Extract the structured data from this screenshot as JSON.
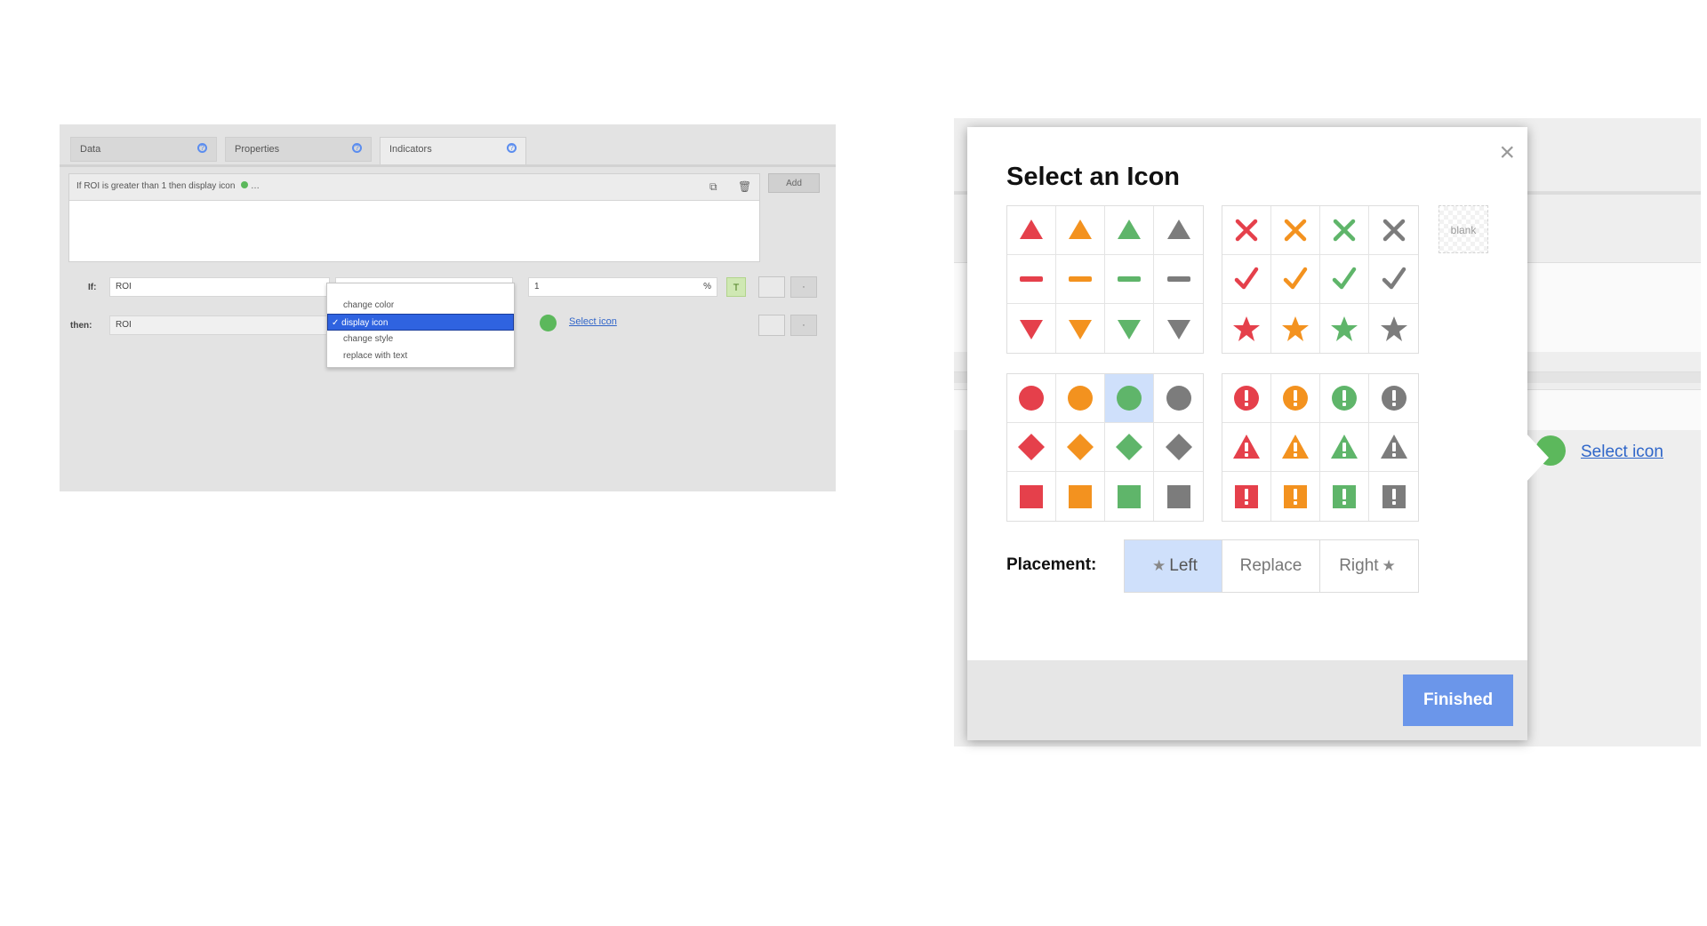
{
  "left_panel": {
    "tabs": [
      {
        "label": "Data",
        "active": false
      },
      {
        "label": "Properties",
        "active": false
      },
      {
        "label": "Indicators",
        "active": true
      }
    ],
    "tab_help": "?",
    "rule_summary": "If ROI is greater than 1 then display icon",
    "add_label": "Add",
    "if_label": "If:",
    "if_field": "ROI",
    "value_field": "1",
    "value_unit": "%",
    "then_label": "then:",
    "then_field": "ROI",
    "operator_options": [
      "change color",
      "display icon",
      "change style",
      "replace with text"
    ],
    "selected_option": "✓ display icon",
    "select_icon_link": "Select icon"
  },
  "modal": {
    "title": "Select an Icon",
    "close_glyph": "×",
    "blank_label": "blank",
    "placement_label": "Placement:",
    "placement_options": [
      "Left",
      "Replace",
      "Right"
    ],
    "placement_selected": "Left",
    "finished_label": "Finished",
    "colors": {
      "red": "#e5404b",
      "orange": "#f3921f",
      "green": "#5fb56a",
      "grey": "#7c7c7c"
    },
    "icon_sets": [
      [
        "triangle-up",
        "dash",
        "triangle-down"
      ],
      [
        "cross",
        "check",
        "star"
      ],
      [
        "circle",
        "diamond",
        "square"
      ],
      [
        "exclamation-circle",
        "warning-triangle",
        "exclamation-square"
      ]
    ],
    "selected_icon": "circle-green"
  },
  "right_background": {
    "select_icon_link": "Select icon"
  }
}
